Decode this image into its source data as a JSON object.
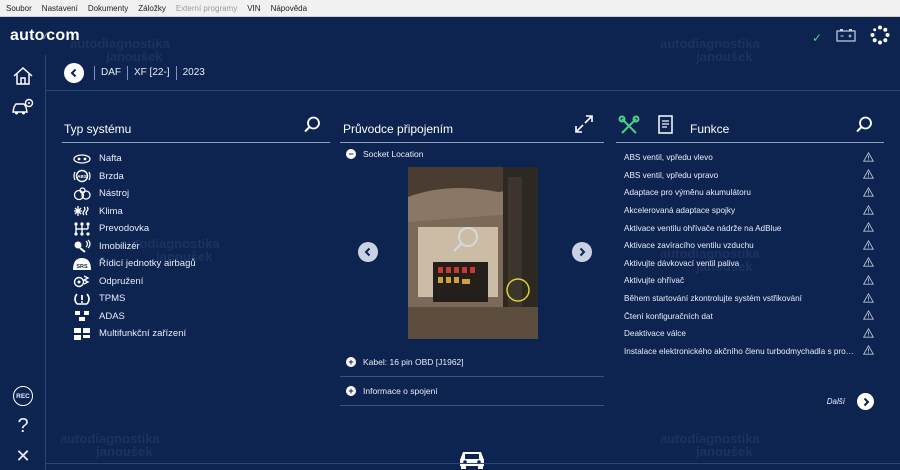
{
  "menu": [
    "Soubor",
    "Nastavení",
    "Dokumenty",
    "Záložky",
    "Externí programy",
    "VIN",
    "Nápověda"
  ],
  "menu_disabled": [
    "Externí programy"
  ],
  "logo": {
    "left": "auto",
    "amp": "⁄",
    "right": "com"
  },
  "breadcrumb": [
    "DAF",
    "XF [22-]",
    "2023"
  ],
  "systems": {
    "title": "Typ systému",
    "items": [
      {
        "label": "Nafta",
        "icon": "injector-icon"
      },
      {
        "label": "Brzda",
        "icon": "brake-icon"
      },
      {
        "label": "Nástroj",
        "icon": "instrument-icon"
      },
      {
        "label": "Klima",
        "icon": "climate-icon"
      },
      {
        "label": "Prevodovka",
        "icon": "gearbox-icon"
      },
      {
        "label": "Imobilizér",
        "icon": "immobilizer-icon"
      },
      {
        "label": "Řídicí jednotky airbagů",
        "icon": "airbag-srs-icon"
      },
      {
        "label": "Odpružení",
        "icon": "suspension-icon"
      },
      {
        "label": "TPMS",
        "icon": "tpms-icon"
      },
      {
        "label": "ADAS",
        "icon": "adas-icon"
      },
      {
        "label": "Multifunkční zařízení",
        "icon": "multifunction-icon"
      }
    ]
  },
  "guide": {
    "title": "Průvodce připojením",
    "socket_label": "Socket Location",
    "cable_label": "Kabel: 16 pin OBD [J1962]",
    "info_label": "Informace o spojení"
  },
  "functions": {
    "title": "Funkce",
    "items": [
      "ABS ventil, vpředu vlevo",
      "ABS ventil, vpředu vpravo",
      "Adaptace pro výměnu akumulátoru",
      "Akcelerovaná adaptace spojky",
      "Aktivace ventilu ohřívače nádrže na AdBlue",
      "Aktivace zavíracího ventilu vzduchu",
      "Aktivujte dávkovací ventil paliva",
      "Aktivujte ohřívač",
      "Během startování zkontrolujte systém vstřikování",
      "Čtení konfiguračních dat",
      "Deaktivace válce",
      "Instalace elektronického akčního členu turbodmychadla s prom..."
    ],
    "next_label": "Další"
  },
  "sidebar_rec": "REC",
  "help_glyph": "?",
  "close_glyph": "✕",
  "status_check": "✓",
  "colors": {
    "background": "#0d2350",
    "accent_green": "#4fd08a",
    "divider": "#8da0c2"
  }
}
